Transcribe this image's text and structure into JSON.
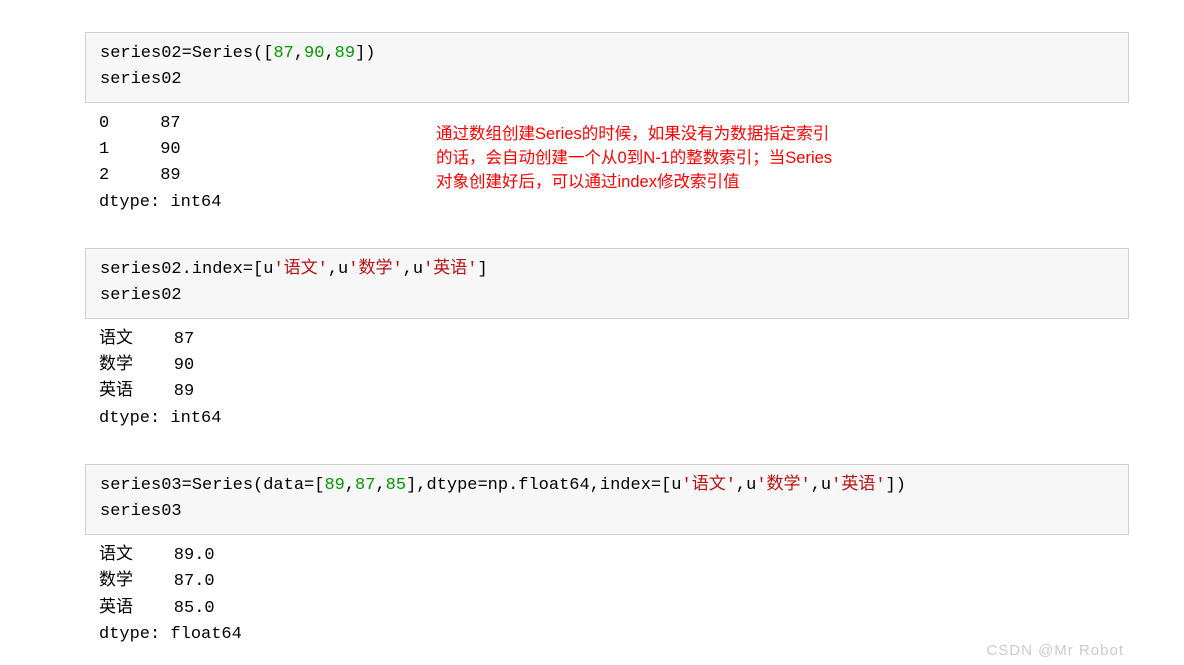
{
  "cell1": {
    "code_line1_a": "series02=Series([",
    "code_line1_num1": "87",
    "code_line1_sep1": ",",
    "code_line1_num2": "90",
    "code_line1_sep2": ",",
    "code_line1_num3": "89",
    "code_line1_b": "])",
    "code_line2": "series02",
    "output": "0     87\n1     90\n2     89\ndtype: int64"
  },
  "annotation": {
    "line1_a": "通过数组创建",
    "line1_b": "Series",
    "line1_c": "的时候，如果没有为数据指定索引",
    "line2_a": "的话，会自动创建一个从",
    "line2_b": "0",
    "line2_c": "到",
    "line2_d": "N-1",
    "line2_e": "的整数索引；当",
    "line2_f": "Series",
    "line3_a": "对象创建好后，可以通过",
    "line3_b": "index",
    "line3_c": "修改索引值"
  },
  "cell2": {
    "code_line1_a": "series02.index=[u",
    "code_line1_s1": "'语文'",
    "code_line1_sep1": ",u",
    "code_line1_s2": "'数学'",
    "code_line1_sep2": ",u",
    "code_line1_s3": "'英语'",
    "code_line1_b": "]",
    "code_line2": "series02",
    "output": "语文    87\n数学    90\n英语    89\ndtype: int64"
  },
  "cell3": {
    "code_line1_a": "series03=Series(data=[",
    "code_line1_num1": "89",
    "code_line1_sep1": ",",
    "code_line1_num2": "87",
    "code_line1_sep2": ",",
    "code_line1_num3": "85",
    "code_line1_b": "],dtype=np.float64,index=[u",
    "code_line1_s1": "'语文'",
    "code_line1_sep3": ",u",
    "code_line1_s2": "'数学'",
    "code_line1_sep4": ",u",
    "code_line1_s3": "'英语'",
    "code_line1_c": "])",
    "code_line2": "series03",
    "output": "语文    89.0\n数学    87.0\n英语    85.0\ndtype: float64"
  },
  "watermark": "CSDN @Mr Robot"
}
